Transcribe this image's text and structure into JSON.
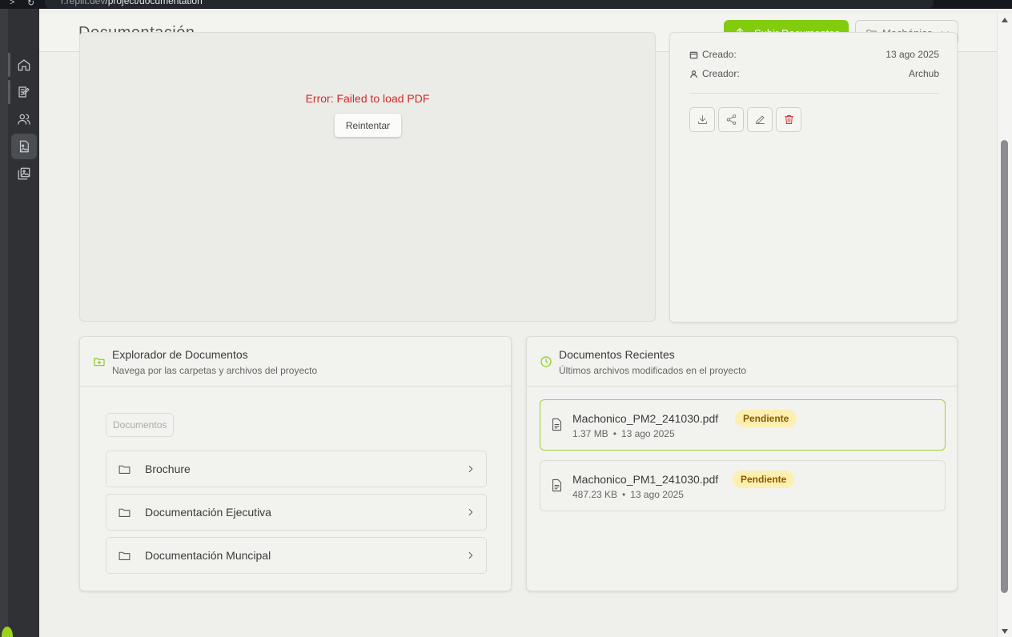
{
  "browser": {
    "url_host": "r.replit.dev",
    "url_path": "/project/documentation"
  },
  "header": {
    "title": "Documentación",
    "upload_label": "Subir Documentos",
    "project_select": "Machónico"
  },
  "viewer": {
    "error_text": "Error: Failed to load PDF",
    "retry_label": "Reintentar"
  },
  "info": {
    "created_label": "Creado:",
    "created_value": "13 ago 2025",
    "creator_label": "Creador:",
    "creator_value": "Archub"
  },
  "explorer": {
    "title": "Explorador de Documentos",
    "subtitle": "Navega por las carpetas y archivos del proyecto",
    "breadcrumb": "Documentos",
    "folders": [
      {
        "name": "Brochure"
      },
      {
        "name": "Documentación Ejecutiva"
      },
      {
        "name": "Documentación Muncipal"
      }
    ]
  },
  "recent": {
    "title": "Documentos Recientes",
    "subtitle": "Últimos archivos modificados en el proyecto",
    "docs": [
      {
        "name": "Machonico_PM2_241030.pdf",
        "status": "Pendiente",
        "size": "1.37 MB",
        "date": "13 ago 2025"
      },
      {
        "name": "Machonico_PM1_241030.pdf",
        "status": "Pendiente",
        "size": "487.23 KB",
        "date": "13 ago 2025"
      }
    ]
  },
  "colors": {
    "accent": "#82cc0e",
    "error": "#d42a2a",
    "badge_bg": "#fcefb0",
    "sidebar": "#2f3134"
  }
}
